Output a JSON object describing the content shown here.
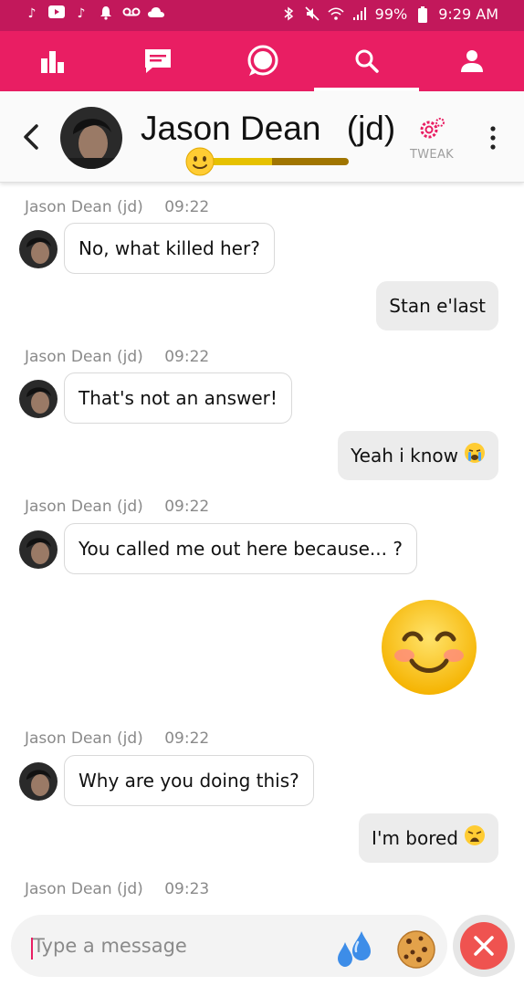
{
  "status_bar": {
    "left_icons": [
      "tiktok-icon",
      "youtube-icon",
      "tiktok-icon",
      "bell-icon",
      "voicemail-icon",
      "cloud-icon"
    ],
    "right_icons": [
      "bluetooth-icon",
      "mute-icon",
      "wifi-icon",
      "signal-icon"
    ],
    "battery": "99%",
    "time": "9:29 AM"
  },
  "nav": {
    "tabs": [
      "stats-icon",
      "chat-icon",
      "bubble-icon",
      "search-icon",
      "profile-icon"
    ],
    "active_tab": 3
  },
  "header": {
    "contact_name": "Jason Dean",
    "contact_nick": "(jd)",
    "mood_level": 0.5,
    "tweak_label": "TWEAK"
  },
  "messages": [
    {
      "from": "them",
      "sender": "Jason Dean",
      "nick": "(jd)",
      "time": "09:22",
      "text": "No, what killed her?"
    },
    {
      "from": "me",
      "text": "Stan e'last"
    },
    {
      "from": "them",
      "sender": "Jason Dean",
      "nick": "(jd)",
      "time": "09:22",
      "text": "That's not an answer!"
    },
    {
      "from": "me",
      "text": "Yeah i know",
      "emoji": "crying-face"
    },
    {
      "from": "them",
      "sender": "Jason Dean",
      "nick": "(jd)",
      "time": "09:22",
      "text": "You called me out here because... ?"
    },
    {
      "from": "me",
      "big_emoji": "smiling-face-with-smiling-eyes"
    },
    {
      "from": "them",
      "sender": "Jason Dean",
      "nick": "(jd)",
      "time": "09:22",
      "text": "Why are you doing this?"
    },
    {
      "from": "me",
      "text": "I'm bored",
      "emoji": "weary-face"
    },
    {
      "from": "them",
      "sender": "Jason Dean",
      "nick": "(jd)",
      "time": "09:23"
    }
  ],
  "composer": {
    "placeholder": "Type a message"
  },
  "colors": {
    "status_bar": "#c2185b",
    "nav_bar": "#e91e63",
    "accent": "#e91e63",
    "close_button": "#ef5350"
  }
}
